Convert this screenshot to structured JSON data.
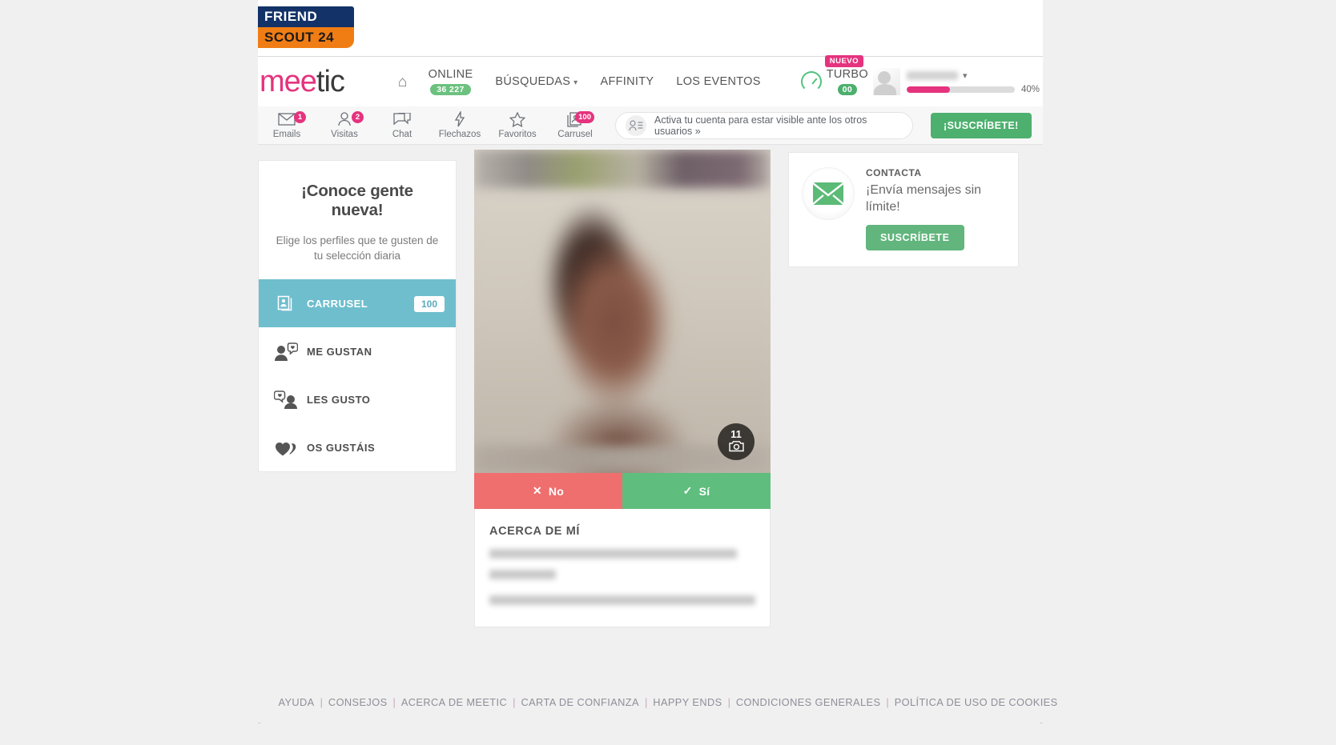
{
  "partner": {
    "logo_top": "FRIEND",
    "logo_bottom": "SCOUT 24"
  },
  "header": {
    "brand_part1": "mee",
    "brand_part2": "tic",
    "home_icon": "home-icon",
    "nav": [
      {
        "label": "ONLINE",
        "badge": "36 227",
        "caret": false
      },
      {
        "label": "BÚSQUEDAS",
        "badge": "",
        "caret": true
      },
      {
        "label": "AFFINITY",
        "badge": "",
        "caret": false
      },
      {
        "label": "LOS EVENTOS",
        "badge": "",
        "caret": false
      }
    ],
    "turbo": {
      "label": "TURBO",
      "badge": "00",
      "new_tag": "NUEVO"
    },
    "user": {
      "progress_label": "40%",
      "progress_value": 40
    }
  },
  "toolbar": {
    "items": [
      {
        "label": "Emails",
        "badge": "1",
        "icon": "envelope-icon"
      },
      {
        "label": "Visitas",
        "badge": "2",
        "icon": "person-icon"
      },
      {
        "label": "Chat",
        "badge": "",
        "icon": "chat-bubbles-icon"
      },
      {
        "label": "Flechazos",
        "badge": "",
        "icon": "lightning-icon"
      },
      {
        "label": "Favoritos",
        "badge": "",
        "icon": "star-icon"
      },
      {
        "label": "Carrusel",
        "badge": "100",
        "icon": "carousel-icon"
      }
    ],
    "activate_text": "Activa tu cuenta para estar visible ante los otros usuarios »",
    "activate_icon": "profile-list-icon",
    "subscribe_label": "¡SUSCRÍBETE!"
  },
  "sidebar": {
    "title": "¡Conoce gente nueva!",
    "subtitle": "Elige los perfiles que te gusten de tu selección diaria",
    "items": [
      {
        "label": "CARRUSEL",
        "badge": "100",
        "icon": "cards-stack-icon",
        "active": true
      },
      {
        "label": "ME GUSTAN",
        "badge": "",
        "icon": "person-heart-right-icon",
        "active": false
      },
      {
        "label": "LES GUSTO",
        "badge": "",
        "icon": "heart-bubble-person-icon",
        "active": false
      },
      {
        "label": "OS GUSTÁIS",
        "badge": "",
        "icon": "double-heart-icon",
        "active": false
      }
    ]
  },
  "profile": {
    "photo_count": "11",
    "photo_icon": "camera-icon",
    "no_label": "No",
    "yes_label": "Sí",
    "about_title": "ACERCA DE MÍ"
  },
  "promo": {
    "kicker": "CONTACTA",
    "title": "¡Envía mensajes sin límite!",
    "button": "SUSCRÍBETE",
    "icon": "envelope-icon"
  },
  "footer": {
    "links": [
      "AYUDA",
      "CONSEJOS",
      "ACERCA DE MEETIC",
      "CARTA DE CONFIANZA",
      "HAPPY ENDS",
      "CONDICIONES GENERALES",
      "POLÍTICA DE USO DE COOKIES"
    ],
    "separator": "|"
  },
  "colors": {
    "brand_pink": "#e5337e",
    "accent_teal": "#6fbecd",
    "green": "#5fbd7e",
    "red": "#ef6e6e"
  }
}
